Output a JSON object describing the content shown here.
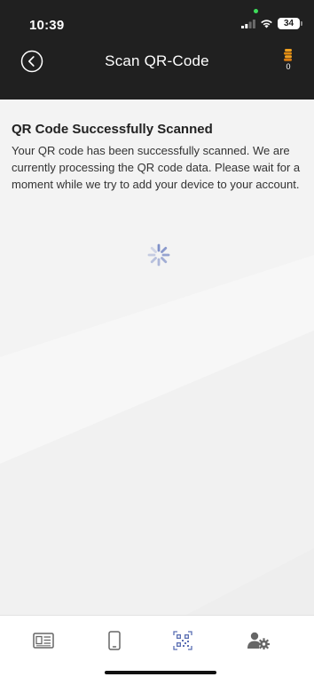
{
  "status_bar": {
    "time": "10:39",
    "battery": "34",
    "icons": [
      "signal-icon",
      "wifi-icon",
      "battery-icon"
    ]
  },
  "nav": {
    "title": "Scan QR-Code",
    "back_icon": "back-circle-icon",
    "coins_icon": "coins-icon",
    "coins_count": "0"
  },
  "message": {
    "title": "QR Code Successfully Scanned",
    "body": "Your QR code has been successfully scanned. We are currently processing the QR code data. Please wait for a moment while we try to add your device to your account."
  },
  "loading": {
    "icon": "loading-spinner-icon"
  },
  "tabs": [
    {
      "id": "news",
      "icon": "news-icon"
    },
    {
      "id": "devices",
      "icon": "device-icon"
    },
    {
      "id": "scan",
      "icon": "qr-code-icon",
      "active": true
    },
    {
      "id": "account",
      "icon": "account-settings-icon"
    }
  ],
  "colors": {
    "header_bg": "#202020",
    "content_bg": "#f3f3f3",
    "active_tab": "#5b6fb3",
    "inactive_tab": "#666666",
    "coins": "#f0a020",
    "spinner": "#7f90c8"
  }
}
